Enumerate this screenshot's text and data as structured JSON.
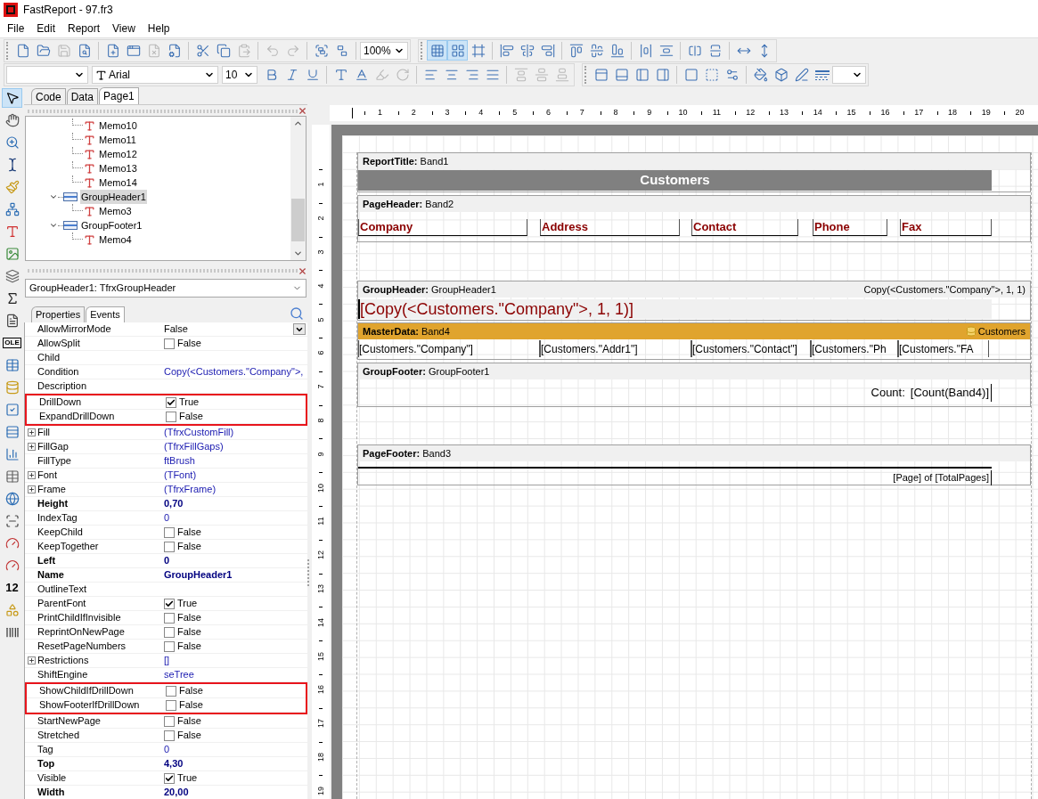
{
  "window": {
    "title": "FastReport - 97.fr3"
  },
  "menu": [
    "File",
    "Edit",
    "Report",
    "View",
    "Help"
  ],
  "toolbar_1": {
    "groups": [
      [
        {
          "disabled": false
        },
        {
          "disabled": false
        },
        {
          "disabled": true
        },
        {
          "disabled": false
        }
      ],
      [
        {
          "disabled": false
        },
        {
          "disabled": false
        },
        {
          "disabled": true
        },
        {
          "disabled": false
        }
      ],
      [
        {
          "disabled": false
        },
        {
          "disabled": false
        },
        {
          "disabled": true
        }
      ],
      [
        {
          "disabled": true
        },
        {
          "disabled": true
        }
      ],
      [
        {
          "disabled": false
        },
        {
          "disabled": false
        }
      ]
    ],
    "zoom": "100%"
  },
  "toolbar_1b": {
    "groups": [
      [
        {
          "pressed": true
        },
        {
          "pressed": true
        },
        {
          "pressed": false
        }
      ],
      [
        {
          "pressed": false
        },
        {
          "pressed": false
        },
        {
          "pressed": false
        }
      ],
      [
        {
          "pressed": false
        },
        {
          "pressed": false
        },
        {
          "pressed": false
        }
      ],
      [
        {
          "pressed": false
        },
        {
          "pressed": false
        }
      ],
      [
        {
          "pressed": false
        },
        {
          "pressed": false
        }
      ],
      [
        {
          "pressed": false
        },
        {
          "pressed": false
        }
      ]
    ]
  },
  "toolbar_2": {
    "font": "Arial",
    "size": "10",
    "groups": [
      [
        {
          "disabled": false
        },
        {
          "disabled": false
        },
        {
          "disabled": false
        }
      ],
      [
        {
          "disabled": false
        },
        {
          "disabled": false
        },
        {
          "disabled": true
        },
        {
          "disabled": true
        }
      ],
      [
        {
          "disabled": false
        },
        {
          "disabled": false
        },
        {
          "disabled": false
        },
        {
          "disabled": false
        }
      ],
      [
        {
          "disabled": true
        },
        {
          "disabled": true
        },
        {
          "disabled": true
        }
      ]
    ]
  },
  "toolbar_2b": {
    "groups": [
      [
        {
          "disabled": false
        },
        {
          "disabled": false
        },
        {
          "disabled": false
        },
        {
          "disabled": false
        }
      ],
      [
        {
          "disabled": false
        },
        {
          "disabled": false
        },
        {
          "disabled": false
        }
      ],
      [
        {
          "disabled": false
        },
        {
          "disabled": false
        },
        {
          "disabled": false
        },
        {
          "disabled": false
        }
      ]
    ]
  },
  "toolbox": {
    "items": [
      {
        "selected": true
      },
      {
        "selected": false
      },
      {
        "selected": false
      },
      {
        "selected": false
      },
      {
        "selected": false
      },
      {
        "selected": false
      },
      {
        "selected": false
      },
      {
        "selected": false
      },
      {
        "selected": false
      },
      {
        "selected": false
      },
      {
        "selected": false
      },
      {
        "selected": false
      },
      {
        "selected": false
      },
      {
        "selected": false
      },
      {
        "selected": false
      },
      {
        "selected": false
      },
      {
        "selected": false
      },
      {
        "selected": false
      },
      {
        "selected": false
      },
      {
        "selected": false
      },
      {
        "selected": false
      },
      {
        "selected": false
      },
      {
        "selected": false
      },
      {
        "selected": false
      },
      {
        "selected": false
      }
    ],
    "ole_label": "OLE",
    "digits_label": "12"
  },
  "tabs": [
    {
      "label": "Code",
      "selected": false
    },
    {
      "label": "Data",
      "selected": false
    },
    {
      "label": "Page1",
      "selected": true
    }
  ],
  "tree": {
    "continued_children": [
      {
        "label": "Memo10"
      },
      {
        "label": "Memo11"
      },
      {
        "label": "Memo12"
      },
      {
        "label": "Memo13"
      },
      {
        "label": "Memo14"
      }
    ],
    "items": [
      {
        "label": "GroupHeader1",
        "expanded": true,
        "selected": true,
        "children": [
          {
            "label": "Memo3"
          }
        ]
      },
      {
        "label": "GroupFooter1",
        "expanded": true,
        "selected": false,
        "children": [
          {
            "label": "Memo4"
          }
        ]
      }
    ]
  },
  "object_selector": "GroupHeader1: TfrxGroupHeader",
  "inspector_tabs": [
    {
      "label": "Properties",
      "selected": true
    },
    {
      "label": "Events",
      "selected": false
    }
  ],
  "properties": [
    {
      "name": "AllowMirrorMode",
      "value": "False",
      "kind": "select",
      "bold": false,
      "expandable": false,
      "highlighted": false
    },
    {
      "name": "AllowSplit",
      "value": "False",
      "kind": "check",
      "checked": false,
      "bold": false,
      "expandable": false,
      "highlighted": false
    },
    {
      "name": "Child",
      "kind": "text",
      "bold": false,
      "expandable": false,
      "highlighted": false
    },
    {
      "name": "Condition",
      "value": "Copy(<Customers.\"Company\">,",
      "kind": "text",
      "bold": false,
      "expandable": false,
      "highlighted": false
    },
    {
      "name": "Description",
      "kind": "text",
      "bold": false,
      "expandable": false,
      "highlighted": false
    },
    {
      "name": "DrillDown",
      "value": "True",
      "kind": "check",
      "checked": true,
      "bold": false,
      "expandable": false,
      "highlighted": true
    },
    {
      "name": "ExpandDrillDown",
      "value": "False",
      "kind": "check",
      "checked": false,
      "bold": false,
      "expandable": false,
      "highlighted": true
    },
    {
      "name": "Fill",
      "value": "(TfrxCustomFill)",
      "kind": "text",
      "bold": false,
      "expandable": true,
      "highlighted": false
    },
    {
      "name": "FillGap",
      "value": "(TfrxFillGaps)",
      "kind": "text",
      "bold": false,
      "expandable": true,
      "highlighted": false
    },
    {
      "name": "FillType",
      "value": "ftBrush",
      "kind": "text",
      "bold": false,
      "expandable": false,
      "highlighted": false
    },
    {
      "name": "Font",
      "value": "(TFont)",
      "kind": "text",
      "bold": false,
      "expandable": true,
      "highlighted": false
    },
    {
      "name": "Frame",
      "value": "(TfrxFrame)",
      "kind": "text",
      "bold": false,
      "expandable": true,
      "highlighted": false
    },
    {
      "name": "Height",
      "value": "0,70",
      "kind": "text",
      "bold": true,
      "expandable": false,
      "highlighted": false
    },
    {
      "name": "IndexTag",
      "value": "0",
      "kind": "text",
      "bold": false,
      "expandable": false,
      "highlighted": false
    },
    {
      "name": "KeepChild",
      "value": "False",
      "kind": "check",
      "checked": false,
      "bold": false,
      "expandable": false,
      "highlighted": false
    },
    {
      "name": "KeepTogether",
      "value": "False",
      "kind": "check",
      "checked": false,
      "bold": false,
      "expandable": false,
      "highlighted": false
    },
    {
      "name": "Left",
      "value": "0",
      "kind": "text",
      "bold": true,
      "expandable": false,
      "highlighted": false
    },
    {
      "name": "Name",
      "value": "GroupHeader1",
      "kind": "text",
      "bold": true,
      "expandable": false,
      "highlighted": false
    },
    {
      "name": "OutlineText",
      "kind": "text",
      "bold": false,
      "expandable": false,
      "highlighted": false
    },
    {
      "name": "ParentFont",
      "value": "True",
      "kind": "check",
      "checked": true,
      "bold": false,
      "expandable": false,
      "highlighted": false
    },
    {
      "name": "PrintChildIfInvisible",
      "value": "False",
      "kind": "check",
      "checked": false,
      "bold": false,
      "expandable": false,
      "highlighted": false
    },
    {
      "name": "ReprintOnNewPage",
      "value": "False",
      "kind": "check",
      "checked": false,
      "bold": false,
      "expandable": false,
      "highlighted": false
    },
    {
      "name": "ResetPageNumbers",
      "value": "False",
      "kind": "check",
      "checked": false,
      "bold": false,
      "expandable": false,
      "highlighted": false
    },
    {
      "name": "Restrictions",
      "value": "[]",
      "kind": "text",
      "bold": false,
      "expandable": true,
      "highlighted": false
    },
    {
      "name": "ShiftEngine",
      "value": "seTree",
      "kind": "text",
      "bold": false,
      "expandable": false,
      "highlighted": false
    },
    {
      "name": "ShowChildIfDrillDown",
      "value": "False",
      "kind": "check",
      "checked": false,
      "bold": false,
      "expandable": false,
      "highlighted": true
    },
    {
      "name": "ShowFooterIfDrillDown",
      "value": "False",
      "kind": "check",
      "checked": false,
      "bold": false,
      "expandable": false,
      "highlighted": true
    },
    {
      "name": "StartNewPage",
      "value": "False",
      "kind": "check",
      "checked": false,
      "bold": false,
      "expandable": false,
      "highlighted": false
    },
    {
      "name": "Stretched",
      "value": "False",
      "kind": "check",
      "checked": false,
      "bold": false,
      "expandable": false,
      "highlighted": false
    },
    {
      "name": "Tag",
      "value": "0",
      "kind": "text",
      "bold": false,
      "expandable": false,
      "highlighted": false
    },
    {
      "name": "Top",
      "value": "4,30",
      "kind": "text",
      "bold": true,
      "expandable": false,
      "highlighted": false
    },
    {
      "name": "Visible",
      "value": "True",
      "kind": "check",
      "checked": true,
      "bold": false,
      "expandable": false,
      "highlighted": false
    },
    {
      "name": "Width",
      "value": "20,00",
      "kind": "text",
      "bold": true,
      "expandable": false,
      "highlighted": false
    }
  ],
  "ruler": {
    "horizontal": [
      "1",
      "2",
      "3",
      "4",
      "5",
      "6",
      "7",
      "8",
      "9",
      "10",
      "11",
      "12",
      "13",
      "14",
      "15",
      "16",
      "17",
      "18",
      "19",
      "20"
    ],
    "vertical": [
      "1",
      "2",
      "3",
      "4",
      "5",
      "6",
      "7",
      "8",
      "9",
      "10",
      "11",
      "12",
      "13",
      "14",
      "15",
      "16",
      "17",
      "18",
      "19"
    ]
  },
  "bands": [
    {
      "kind": "report_title",
      "title": "ReportTitle:",
      "name": "Band1",
      "color": "#f0f0f0",
      "objects": [
        {
          "text": "Customers"
        }
      ]
    },
    {
      "kind": "page_header",
      "title": "PageHeader:",
      "name": "Band2",
      "color": "#f0f0f0",
      "objects": [
        {
          "text": "Company"
        },
        {
          "text": "Address"
        },
        {
          "text": "Contact"
        },
        {
          "text": "Phone"
        },
        {
          "text": "Fax"
        }
      ]
    },
    {
      "kind": "group_header",
      "title": "GroupHeader:",
      "name": "GroupHeader1",
      "color": "#f0f0f0",
      "right_text": "Copy(<Customers.\"Company\">, 1, 1)",
      "objects": [
        {
          "text": "[Copy(<Customers.\"Company\">, 1, 1)]"
        }
      ]
    },
    {
      "kind": "master_data",
      "title": "MasterData:",
      "name": "Band4",
      "color": "#e0a42e",
      "right_text": "Customers",
      "objects": [
        {
          "text": "[Customers.\"Company\"]"
        },
        {
          "text": "[Customers.\"Addr1\"]"
        },
        {
          "text": "[Customers.\"Contact\"]"
        },
        {
          "text": "[Customers.\"Ph"
        },
        {
          "text": "[Customers.\"FA"
        }
      ]
    },
    {
      "kind": "group_footer",
      "title": "GroupFooter:",
      "name": "GroupFooter1",
      "color": "#f0f0f0",
      "objects": [
        {
          "text": "Count:"
        },
        {
          "text": "[Count(Band4)]"
        }
      ]
    },
    {
      "kind": "page_footer",
      "title": "PageFooter:",
      "name": "Band3",
      "color": "#f0f0f0",
      "objects": [
        {
          "text": "[Page] of [TotalPages]"
        }
      ]
    }
  ]
}
